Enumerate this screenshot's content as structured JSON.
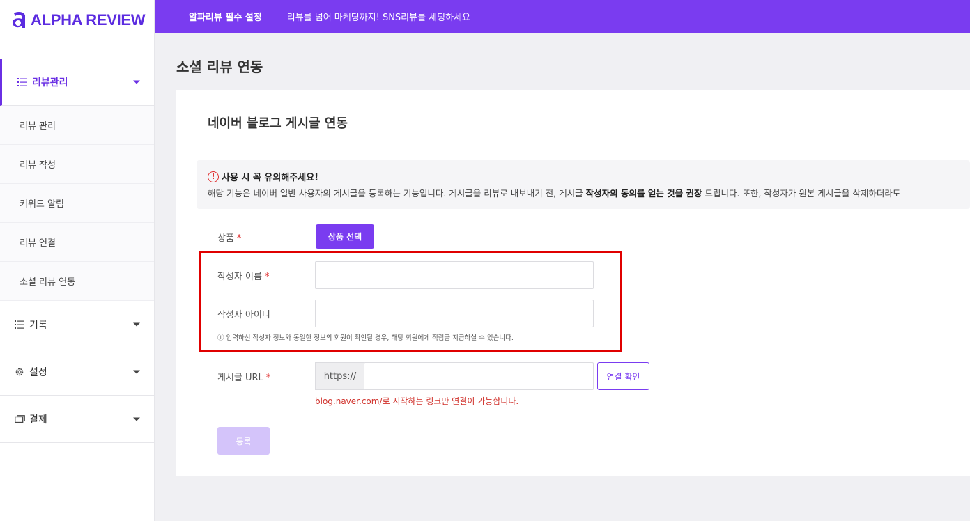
{
  "brand": {
    "name": "ALPHA REVIEW",
    "color": "#5b2be0"
  },
  "topbar": {
    "title": "알파리뷰 필수 설정",
    "message": "리뷰를 넘어 마케팅까지! SNS리뷰를 세팅하세요",
    "color": "#7a3cf0"
  },
  "sidebar": {
    "sections": [
      {
        "label": "리뷰관리",
        "icon": "list-icon",
        "active": true,
        "items": [
          "리뷰 관리",
          "리뷰 작성",
          "키워드 알림",
          "리뷰 연결",
          "소셜 리뷰 연동"
        ]
      },
      {
        "label": "기록",
        "icon": "list-icon",
        "active": false
      },
      {
        "label": "설정",
        "icon": "gear-icon",
        "active": false
      },
      {
        "label": "결제",
        "icon": "card-icon",
        "active": false
      }
    ]
  },
  "page": {
    "title": "소셜 리뷰 연동"
  },
  "card": {
    "title": "네이버 블로그 게시글 연동",
    "notice": {
      "heading": "사용 시 꼭 유의해주세요!",
      "body_before": "해당 기능은 네이버 일반 사용자의 게시글을 등록하는 기능입니다. 게시글을 리뷰로 내보내기 전, 게시글 ",
      "body_bold": "작성자의 동의를 얻는 것을 권장",
      "body_after": " 드립니다. 또한, 작성자가 원본 게시글을 삭제하더라도"
    },
    "form": {
      "product_label": "상품",
      "product_button": "상품 선택",
      "author_name_label": "작성자 이름",
      "author_name_value": "",
      "author_id_label": "작성자 아이디",
      "author_id_value": "",
      "hint": "ⓘ 입력하신 작성자 정보와 동일한 정보의 회원이 확인될 경우, 해당 회원에게 적립금 지급하실 수 있습니다.",
      "url_label": "게시글 URL",
      "url_prefix": "https://",
      "url_value": "",
      "url_check_button": "연결 확인",
      "url_error": "blog.naver.com/로 시작하는 링크만 연결이 가능합니다.",
      "submit_button": "등록",
      "required_mark": "*"
    }
  }
}
